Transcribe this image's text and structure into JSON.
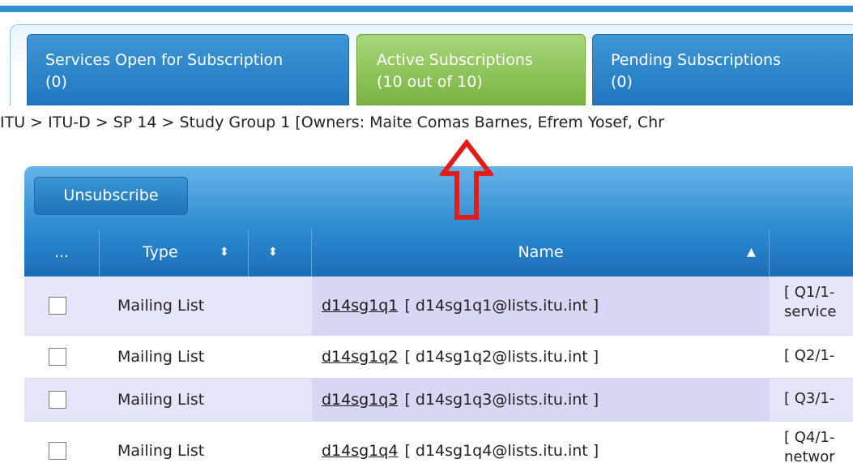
{
  "tabs": [
    {
      "label": "Services Open for Subscription",
      "count": "(0)",
      "active": false
    },
    {
      "label": "Active Subscriptions",
      "count": "(10 out of 10)",
      "active": true
    },
    {
      "label": "Pending Subscriptions",
      "count": "(0)",
      "active": false
    }
  ],
  "breadcrumb": "ITU > ITU-D > SP 14 > Study Group 1 [Owners: Maite Comas Barnes, Efrem Yosef, Chr",
  "toolbar": {
    "unsubscribe_label": "Unsubscribe"
  },
  "table": {
    "headers": {
      "more": "...",
      "type": "Type",
      "name": "Name"
    },
    "rows": [
      {
        "type": "Mailing List",
        "name": "d14sg1q1",
        "email": "[ d14sg1q1@lists.itu.int ]",
        "desc_line1": "[ Q1/1-",
        "desc_line2": "service"
      },
      {
        "type": "Mailing List",
        "name": "d14sg1q2",
        "email": "[ d14sg1q2@lists.itu.int ]",
        "desc_line1": "[ Q2/1-",
        "desc_line2": ""
      },
      {
        "type": "Mailing List",
        "name": "d14sg1q3",
        "email": "[ d14sg1q3@lists.itu.int ]",
        "desc_line1": "[ Q3/1-",
        "desc_line2": ""
      },
      {
        "type": "Mailing List",
        "name": "d14sg1q4",
        "email": "[ d14sg1q4@lists.itu.int ]",
        "desc_line1": "[ Q4/1-",
        "desc_line2": "networ"
      }
    ]
  },
  "colors": {
    "accent_blue": "#2f8fd0",
    "active_tab_green": "#8cc45a",
    "annotation_red": "#e21b1b"
  }
}
